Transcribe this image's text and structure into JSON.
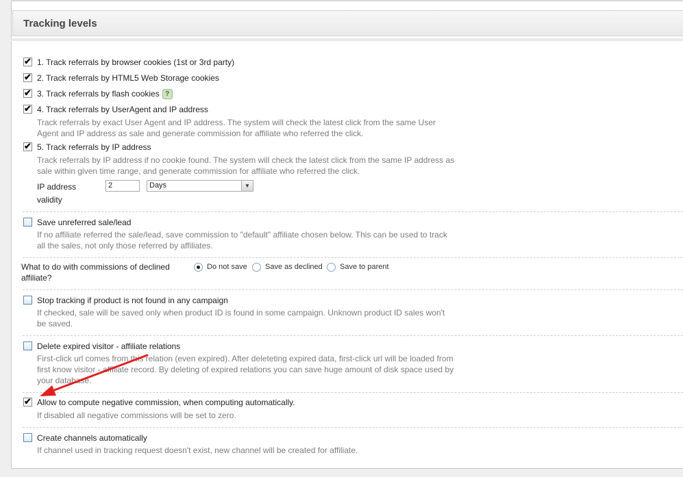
{
  "section": {
    "title": "Tracking levels"
  },
  "items": [
    {
      "label": "1. Track referrals by browser cookies (1st or 3rd party)",
      "checked": true
    },
    {
      "label": "2. Track referrals by HTML5 Web Storage cookies",
      "checked": true
    },
    {
      "label": "3. Track referrals by flash cookies",
      "checked": true,
      "help_icon": "help-icon"
    },
    {
      "label": "4. Track referrals by UserAgent and IP address",
      "checked": true,
      "desc": "Track referrals by exact User Agent and IP address. The system will check the latest click from the same User Agent and IP address as sale and generate commission for affiliate who referred the click."
    },
    {
      "label": "5. Track referrals by IP address",
      "checked": true,
      "desc": "Track referrals by IP address if no cookie found. The system will check the latest click from the same IP address as sale within given time range, and generate commission for affiliate who referred the click."
    }
  ],
  "ip_validity": {
    "label_line1": "IP address",
    "label_line2": "validity",
    "value": "2",
    "unit": "Days"
  },
  "save_unreferred": {
    "label": "Save unreferred sale/lead",
    "checked": false,
    "desc": "If no affiliate referred the sale/lead, save commission to \"default\" affiliate chosen below. This can be used to track all the sales, not only those referred by affiliates."
  },
  "declined": {
    "question_line1": "What to do with commissions of declined",
    "question_line2": "affiliate?",
    "options": [
      {
        "label": "Do not save",
        "selected": true
      },
      {
        "label": "Save as declined",
        "selected": false
      },
      {
        "label": "Save to parent",
        "selected": false
      }
    ]
  },
  "stop_tracking": {
    "label": "Stop tracking if product is not found in any campaign",
    "checked": false,
    "desc": "If checked, sale will be saved only when product ID is found in some campaign. Unknown product ID sales won't be saved."
  },
  "delete_expired": {
    "label": "Delete expired visitor - affiliate relations",
    "checked": false,
    "desc": "First-click url comes from this relation (even expired). After deleteting expired data, first-click url will be loaded from first know visitor - affiliate record. By deleting of expired relations you can save huge amount of disk space used by your database."
  },
  "negative_commission": {
    "label": "Allow to compute negative commission, when computing automatically.",
    "checked": true,
    "desc": "If disabled all negative commissions will be set to zero."
  },
  "create_channels": {
    "label": "Create channels automatically",
    "checked": false,
    "desc": "If channel used in tracking request doesn't exist, new channel will be created for affiliate."
  },
  "annotation_color": "#e02020"
}
